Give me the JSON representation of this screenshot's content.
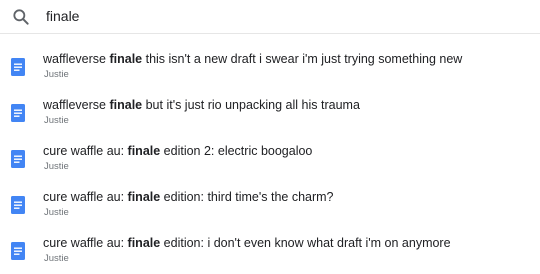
{
  "search": {
    "query": "finale"
  },
  "results": [
    {
      "prefix": "waffleverse ",
      "match": "finale",
      "suffix": " this isn't a new draft i swear i'm just trying something new",
      "owner": "Justie",
      "icon": "docs-icon"
    },
    {
      "prefix": "waffleverse ",
      "match": "finale",
      "suffix": " but it's just rio unpacking all his trauma",
      "owner": "Justie",
      "icon": "docs-icon"
    },
    {
      "prefix": "cure waffle au: ",
      "match": "finale",
      "suffix": " edition 2: electric boogaloo",
      "owner": "Justie",
      "icon": "docs-icon"
    },
    {
      "prefix": "cure waffle au: ",
      "match": "finale",
      "suffix": " edition: third time's the charm?",
      "owner": "Justie",
      "icon": "docs-icon"
    },
    {
      "prefix": "cure waffle au: ",
      "match": "finale",
      "suffix": " edition: i don't even know what draft i'm on anymore",
      "owner": "Justie",
      "icon": "docs-icon"
    }
  ],
  "colors": {
    "docs_blue": "#4285f4",
    "text": "#202124",
    "secondary_text": "#70757a"
  }
}
